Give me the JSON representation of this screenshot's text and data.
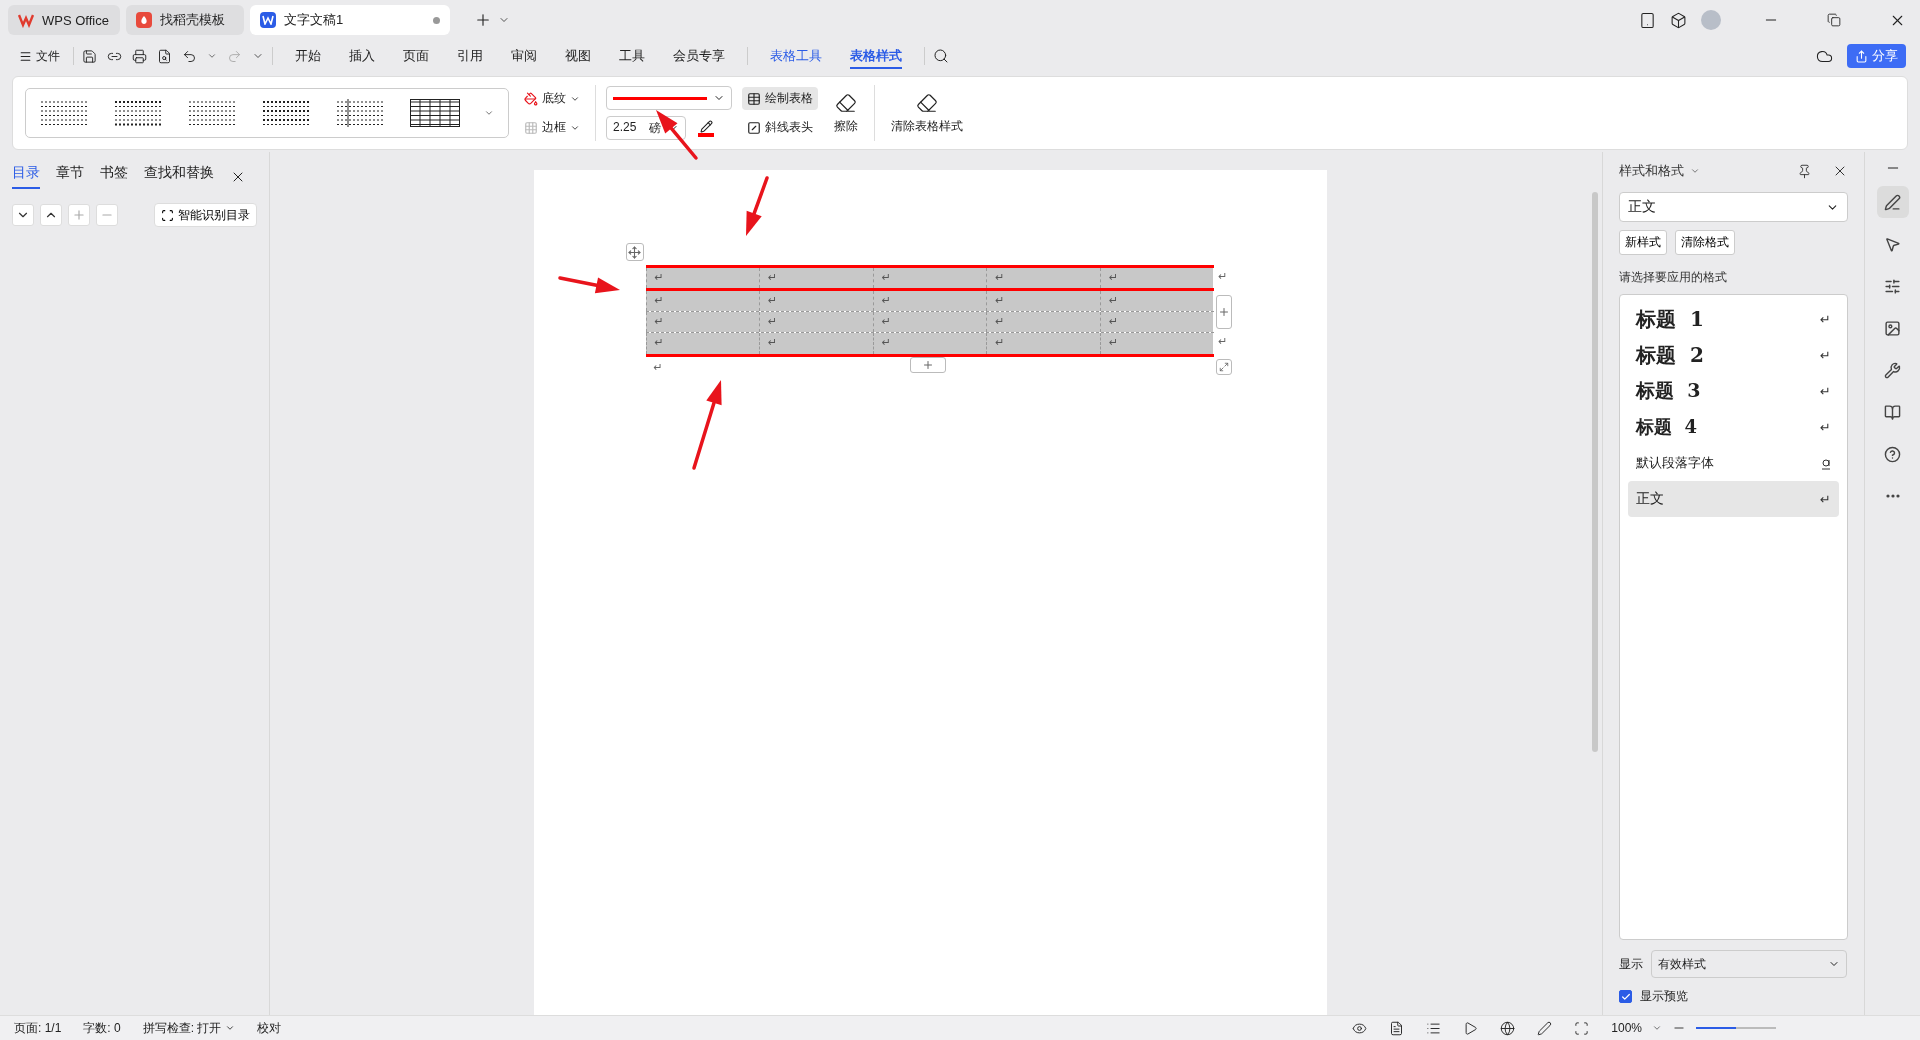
{
  "tabs": [
    {
      "label": "WPS Office",
      "kind": "wps",
      "selected": false
    },
    {
      "label": "找稻壳模板",
      "kind": "docer",
      "selected": false
    },
    {
      "label": "文字文稿1",
      "kind": "writer",
      "selected": true
    }
  ],
  "menu": {
    "file": "文件",
    "items": [
      {
        "label": "开始",
        "contextual": false,
        "selected": false
      },
      {
        "label": "插入",
        "contextual": false,
        "selected": false
      },
      {
        "label": "页面",
        "contextual": false,
        "selected": false
      },
      {
        "label": "引用",
        "contextual": false,
        "selected": false
      },
      {
        "label": "审阅",
        "contextual": false,
        "selected": false
      },
      {
        "label": "视图",
        "contextual": false,
        "selected": false
      },
      {
        "label": "工具",
        "contextual": false,
        "selected": false
      },
      {
        "label": "会员专享",
        "contextual": false,
        "selected": false
      },
      {
        "label": "表格工具",
        "contextual": true,
        "selected": false
      },
      {
        "label": "表格样式",
        "contextual": true,
        "selected": true
      }
    ],
    "share": "分享"
  },
  "ribbon": {
    "shading": "底纹",
    "border": "边框",
    "line_weight": "2.25",
    "line_unit": "磅",
    "draw_table": {
      "label": "绘制表格",
      "selected": true
    },
    "diagonal": "斜线表头",
    "erase": "擦除",
    "clear_style": "清除表格样式"
  },
  "nav": {
    "tabs": [
      {
        "label": "目录",
        "selected": true
      },
      {
        "label": "章节",
        "selected": false
      },
      {
        "label": "书签",
        "selected": false
      },
      {
        "label": "查找和替换",
        "selected": false
      }
    ],
    "smart_toc": "智能识别目录"
  },
  "document": {
    "table": {
      "rows": [
        {
          "header": true,
          "cells": [
            "↵",
            "↵",
            "↵",
            "↵",
            "↵"
          ],
          "row_end": "↵"
        },
        {
          "header": false,
          "cells": [
            "↵",
            "↵",
            "↵",
            "↵",
            "↵"
          ]
        },
        {
          "header": false,
          "cells": [
            "↵",
            "↵",
            "↵",
            "↵",
            "↵"
          ]
        },
        {
          "header": false,
          "cells": [
            "↵",
            "↵",
            "↵",
            "↵",
            "↵"
          ],
          "row_end": "↵"
        }
      ]
    },
    "after_table": "↵"
  },
  "styles_panel": {
    "title": "样式和格式",
    "current": "正文",
    "new_style": "新样式",
    "clear": "清除格式",
    "prompt": "请选择要应用的格式",
    "items": [
      {
        "label": "标题  1",
        "kind": "heading1",
        "mark": "↵",
        "selected": false
      },
      {
        "label": "标题  2",
        "kind": "heading2",
        "mark": "↵",
        "selected": false
      },
      {
        "label": "标题  3",
        "kind": "heading3",
        "mark": "↵",
        "selected": false
      },
      {
        "label": "标题  4",
        "kind": "heading4",
        "mark": "↵",
        "selected": false
      },
      {
        "label": "默认段落字体",
        "kind": "character",
        "selected": false
      },
      {
        "label": "正文",
        "kind": "body",
        "mark": "↵",
        "selected": true
      }
    ],
    "show_label": "显示",
    "show_value": "有效样式",
    "preview": {
      "label": "显示预览",
      "checked": true
    }
  },
  "status_bar": {
    "page": "页面: 1/1",
    "words": "字数: 0",
    "spell": "拼写检查: 打开",
    "proof": "校对",
    "zoom": "100%",
    "zoom_slider": {
      "level": 0.5
    }
  }
}
